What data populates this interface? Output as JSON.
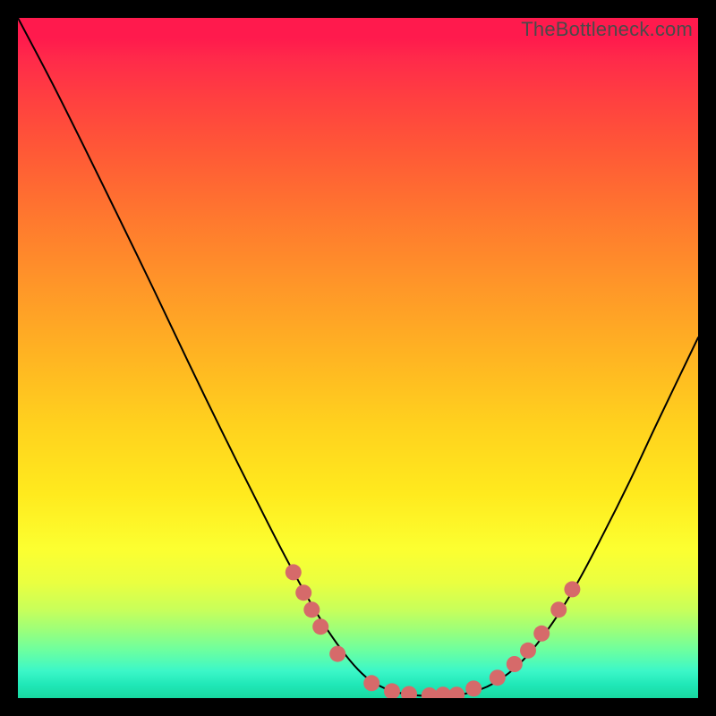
{
  "watermark": "TheBottleneck.com",
  "chart_data": {
    "type": "line",
    "title": "",
    "xlabel": "",
    "ylabel": "",
    "xlim": [
      0,
      100
    ],
    "ylim": [
      0,
      100
    ],
    "grid": false,
    "legend": false,
    "series": [
      {
        "name": "bottleneck-curve",
        "x": [
          0,
          5,
          10,
          15,
          20,
          25,
          30,
          35,
          40,
          45,
          50,
          54,
          58,
          62,
          66,
          70,
          74,
          78,
          82,
          86,
          90,
          94,
          100
        ],
        "y": [
          100,
          90.5,
          80.5,
          70.3,
          60.0,
          49.5,
          39.2,
          29.2,
          19.5,
          10.8,
          4.2,
          1.4,
          0.5,
          0.3,
          0.7,
          2.2,
          5.3,
          10.2,
          16.5,
          24.0,
          32.0,
          40.5,
          53.0
        ]
      }
    ],
    "markers": {
      "name": "highlight-dots",
      "color": "#d66a6a",
      "points": [
        {
          "x": 40.5,
          "y": 18.5
        },
        {
          "x": 42.0,
          "y": 15.5
        },
        {
          "x": 43.2,
          "y": 13.0
        },
        {
          "x": 44.5,
          "y": 10.5
        },
        {
          "x": 47.0,
          "y": 6.5
        },
        {
          "x": 52.0,
          "y": 2.2
        },
        {
          "x": 55.0,
          "y": 1.0
        },
        {
          "x": 57.5,
          "y": 0.6
        },
        {
          "x": 60.5,
          "y": 0.4
        },
        {
          "x": 62.5,
          "y": 0.5
        },
        {
          "x": 64.5,
          "y": 0.5
        },
        {
          "x": 67.0,
          "y": 1.4
        },
        {
          "x": 70.5,
          "y": 3.0
        },
        {
          "x": 73.0,
          "y": 5.0
        },
        {
          "x": 75.0,
          "y": 7.0
        },
        {
          "x": 77.0,
          "y": 9.5
        },
        {
          "x": 79.5,
          "y": 13.0
        },
        {
          "x": 81.5,
          "y": 16.0
        }
      ]
    }
  }
}
